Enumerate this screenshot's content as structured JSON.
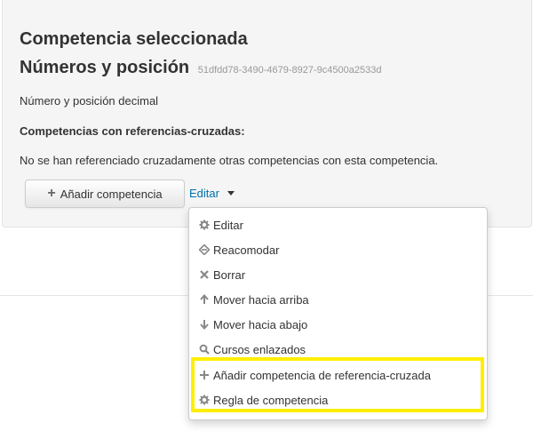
{
  "competency": {
    "heading": "Competencia seleccionada",
    "name": "Números y posición",
    "idnumber": "51dfdd78-3490-4679-8927-9c4500a2533d",
    "description": "Número y posición decimal"
  },
  "crossref": {
    "title": "Competencias con referencias-cruzadas:",
    "empty_text": "No se han referenciado cruzadamente otras competencias con esta competencia."
  },
  "actions": {
    "add_label": "Añadir competencia",
    "edit_label": "Editar"
  },
  "menu": {
    "items": [
      {
        "label": "Editar",
        "icon": "gear-icon"
      },
      {
        "label": "Reacomodar",
        "icon": "move-icon"
      },
      {
        "label": "Borrar",
        "icon": "close-icon"
      },
      {
        "label": "Mover hacia arriba",
        "icon": "arrow-up-icon"
      },
      {
        "label": "Mover hacia abajo",
        "icon": "arrow-down-icon"
      },
      {
        "label": "Cursos enlazados",
        "icon": "search-icon"
      },
      {
        "label": "Añadir competencia de referencia-cruzada",
        "icon": "plus-icon"
      },
      {
        "label": "Regla de competencia",
        "icon": "gear-icon"
      }
    ]
  },
  "colors": {
    "highlight": "#ffee00",
    "link": "#0070a8",
    "panel_bg": "#f5f5f5"
  }
}
